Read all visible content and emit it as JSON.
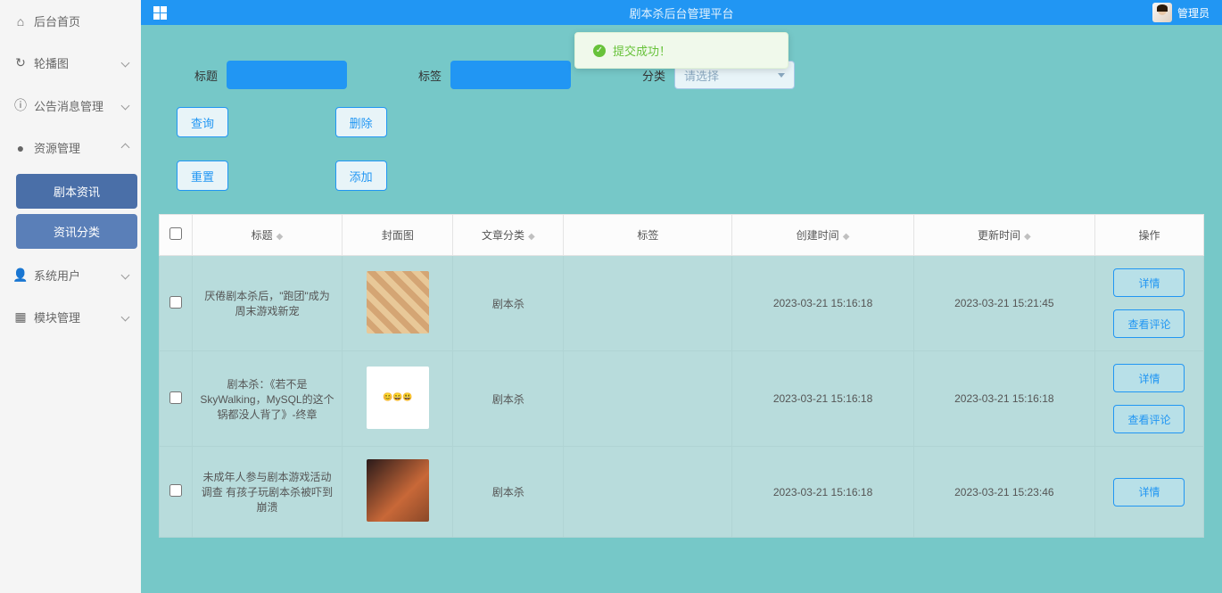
{
  "header": {
    "title": "剧本杀后台管理平台",
    "user_label": "管理员"
  },
  "toast": {
    "text": "提交成功！"
  },
  "sidebar": {
    "items": [
      {
        "icon": "⌂",
        "label": "后台首页"
      },
      {
        "icon": "↻",
        "label": "轮播图"
      },
      {
        "icon": "ⓘ",
        "label": "公告消息管理"
      },
      {
        "icon": "●",
        "label": "资源管理"
      },
      {
        "icon": "👤",
        "label": "系统用户"
      },
      {
        "icon": "▦",
        "label": "模块管理"
      }
    ],
    "sub": {
      "resource_info": "剧本资讯",
      "info_category": "资讯分类"
    }
  },
  "filters": {
    "title_label": "标题",
    "tag_label": "标签",
    "category_label": "分类",
    "category_placeholder": "请选择"
  },
  "buttons": {
    "query": "查询",
    "delete": "删除",
    "reset": "重置",
    "add": "添加",
    "detail": "详情",
    "view_comment": "查看评论"
  },
  "table": {
    "headers": {
      "title": "标题",
      "cover": "封面图",
      "category": "文章分类",
      "tag": "标签",
      "create_time": "创建时间",
      "update_time": "更新时间",
      "actions": "操作"
    },
    "rows": [
      {
        "title": "厌倦剧本杀后，\"跑团\"成为周末游戏新宠",
        "category": "剧本杀",
        "tag": "",
        "create_time": "2023-03-21 15:16:18",
        "update_time": "2023-03-21 15:21:45"
      },
      {
        "title": "剧本杀：《若不是SkyWalking，MySQL的这个锅都没人背了》-终章",
        "category": "剧本杀",
        "tag": "",
        "create_time": "2023-03-21 15:16:18",
        "update_time": "2023-03-21 15:16:18"
      },
      {
        "title": "未成年人参与剧本游戏活动调查 有孩子玩剧本杀被吓到崩溃",
        "category": "剧本杀",
        "tag": "",
        "create_time": "2023-03-21 15:16:18",
        "update_time": "2023-03-21 15:23:46"
      }
    ]
  }
}
